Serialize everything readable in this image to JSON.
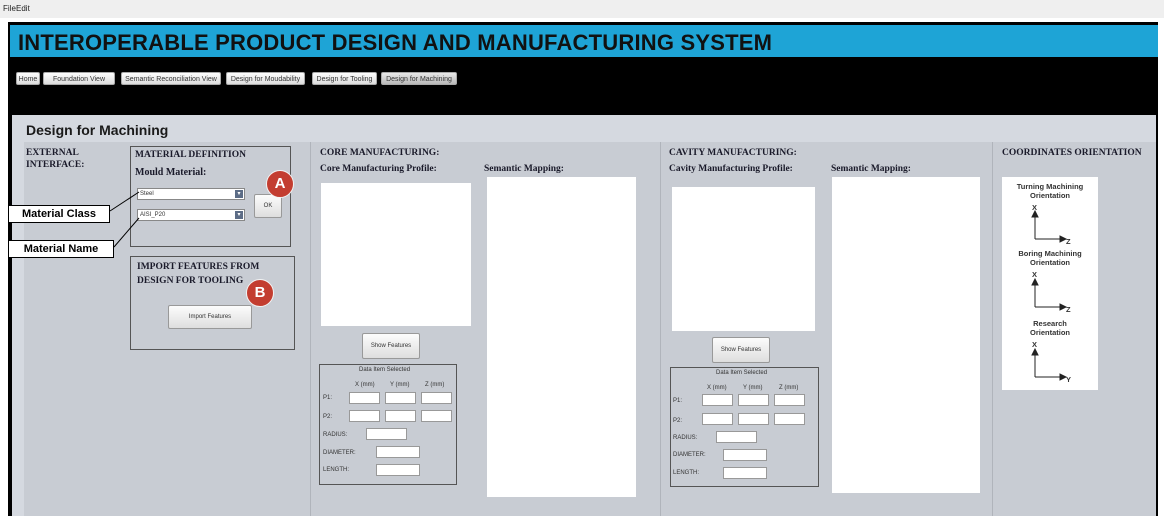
{
  "menu": {
    "file": "File",
    "edit": "Edit"
  },
  "app_title": "INTEROPERABLE PRODUCT DESIGN AND MANUFACTURING SYSTEM",
  "nav": [
    {
      "label": "Home"
    },
    {
      "label": "Foundation View"
    },
    {
      "label": "Semantic Reconciliation View"
    },
    {
      "label": "Design for Moudability"
    },
    {
      "label": "Design for Tooling"
    },
    {
      "label": "Design for Machining"
    }
  ],
  "page_title": "Design for Machining",
  "external_interface": {
    "line1": "EXTERNAL",
    "line2": "INTERFACE:"
  },
  "material": {
    "heading": "MATERIAL DEFINITION",
    "mould_label": "Mould Material:",
    "class_value": "Steel",
    "name_value": "AISI_P20",
    "ok": "OK"
  },
  "import": {
    "heading1": "IMPORT FEATURES FROM",
    "heading2": "DESIGN FOR TOOLING",
    "button": "Import Features"
  },
  "callouts": {
    "a": "A",
    "b": "B",
    "material_class": "Material Class",
    "material_name": "Material Name"
  },
  "core": {
    "heading": "CORE MANUFACTURING:",
    "profile": "Core Manufacturing Profile:",
    "semantic": "Semantic Mapping:",
    "show_button": "Show Features"
  },
  "cavity": {
    "heading": "CAVITY MANUFACTURING:",
    "profile": "Cavity Manufacturing Profile:",
    "semantic": "Semantic Mapping:",
    "show_button": "Show Features"
  },
  "data_item": {
    "title": "Data Item Selected",
    "x": "X (mm)",
    "y": "Y (mm)",
    "z": "Z (mm)",
    "p1": "P1:",
    "p2": "P2:",
    "radius": "RADIUS:",
    "diameter": "DIAMETER:",
    "length": "LENGTH:"
  },
  "coords": {
    "heading": "COORDINATES ORIENTATION",
    "turning1": "Turning Machining",
    "turning2": "Orientation",
    "boring1": "Boring Machining",
    "boring2": "Orientation",
    "research1": "Research",
    "research2": "Orientation",
    "x": "X",
    "z": "Z",
    "y": "Y"
  }
}
